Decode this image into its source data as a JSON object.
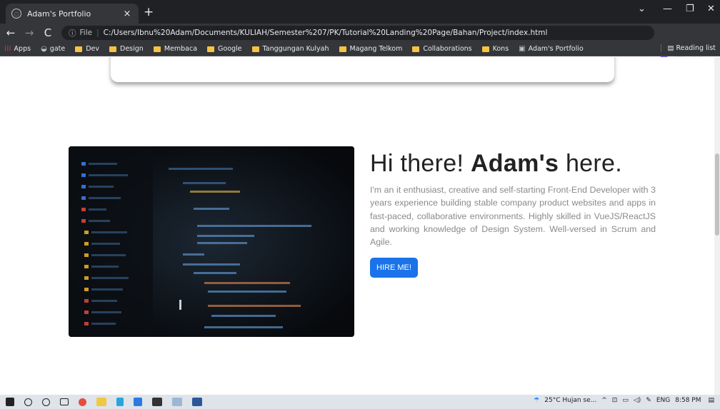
{
  "browser": {
    "tab_title": "Adam's Portfolio",
    "new_tab_symbol": "+",
    "close_symbol": "×",
    "url_prefix": "File",
    "url": "C:/Users/Ibnu%20Adam/Documents/KULIAH/Semester%207/PK/Tutorial%20Landing%20Page/Bahan/Project/index.html",
    "bookmarks": [
      "Apps",
      "gate",
      "Dev",
      "Design",
      "Membaca",
      "Google",
      "Tanggungan Kulyah",
      "Magang Telkom",
      "Collaborations",
      "Kons",
      "Adam's Portfolio"
    ],
    "reading_list": "Reading list"
  },
  "hero": {
    "greeting_pre": "Hi there! ",
    "greeting_name": "Adam's",
    "greeting_post": " here.",
    "description": "I'm an it enthusiast, creative and self-starting Front-End Developer with 3 years experience building stable company product websites and apps in fast-paced, collaborative environments. Highly skilled in VueJS/ReactJS and working knowledge of Design System. Well-versed in Scrum and Agile.",
    "cta_label": "HIRE ME!",
    "cta_color": "#1a73e8"
  },
  "taskbar": {
    "weather": "25°C Hujan se...",
    "language": "ENG",
    "time": "8:58 PM"
  }
}
